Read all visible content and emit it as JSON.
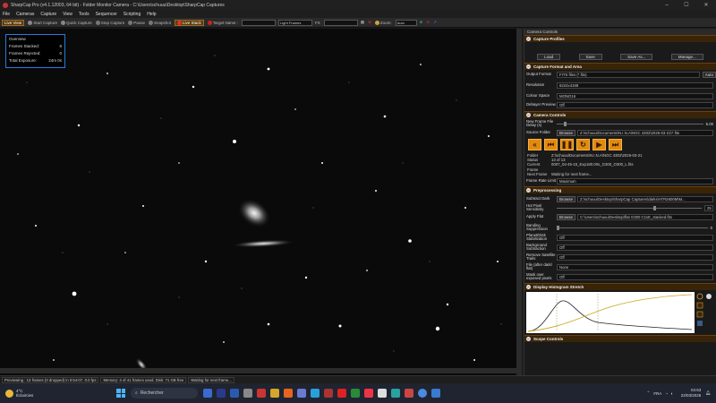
{
  "window": {
    "title": "SharpCap Pro (v4.1.12003, 64 bit) - Folder Monitor Camera - C:\\Users\\schuuu\\Desktop\\SharpCap Captures"
  },
  "menu": [
    "File",
    "Cameras",
    "Capture",
    "View",
    "Tools",
    "Sequencer",
    "Scripting",
    "Help"
  ],
  "toolbar": {
    "live_view": "Live View",
    "start_capture": "Start Capture",
    "quick_capture": "Quick Capture",
    "stop_capture": "Stop Capture",
    "pause": "Pause",
    "snapshot": "Snapshot",
    "live_stack": "Live Stack",
    "target_name": "Target Name :",
    "light_frames": "Light Frames",
    "fx": "FX",
    "zoom_label": "Zoom:",
    "zoom_value": "Auto"
  },
  "overview": {
    "title": "Overview",
    "frames_stacked_label": "Frames Stacked:",
    "frames_stacked": "8",
    "frames_rejected_label": "Frames Rejected:",
    "frames_rejected": "0",
    "total_exposure_label": "Total Exposure:",
    "total_exposure": "24m 0s"
  },
  "panel": {
    "title": "Camera Controls",
    "capture_profiles": "Capture Profiles",
    "load": "Load",
    "save": "Save",
    "save_as": "Save As...",
    "manage": "Manage...",
    "capture_format": "Capture Format and Area",
    "output_format_label": "Output Format",
    "output_format": "FITS files (*.fits)",
    "auto": "Auto",
    "resolution_label": "Resolution",
    "resolution": "6224x4168",
    "colour_space_label": "Colour Space",
    "colour_space": "MONO16",
    "debayer_label": "Debayer Preview",
    "debayer": "Off",
    "camera_controls": "Camera Controls",
    "new_frame_label": "New Frame File Delay (s)",
    "new_frame_value": "5.00",
    "source_folder_label": "Source Folder",
    "browse": "Browse",
    "source_folder": "Z:\\schuuu\\Documents\\N.I.N.A\\NGC 4302\\2026-03-21\\*.fits",
    "folder_label": "Folder",
    "folder": "Z:\\schuuu\\Documents\\N.I.N.A\\NGC 4302\\2026-03-21",
    "status_label": "Status",
    "status": "13 of 13",
    "current_frame_label": "Current Frame",
    "current_frame": "0007_04-45-15_Exp180.00s_G300_O300_L.fits",
    "next_frame_label": "Next Frame",
    "next_frame": "Waiting for next frame...",
    "frame_rate_label": "Frame Rate Limit",
    "frame_rate": "Maximum",
    "preprocessing": "Preprocessing",
    "subtract_dark_label": "Subtract Dark",
    "subtract_dark": "Z:\\schuuu\\Desktop\\SharpCap Captures\\darks\\ATR2600M\\M...",
    "hot_pixel_label": "Hot Pixel Sensitivity",
    "hot_pixel_value": "25",
    "apply_flat_label": "Apply Flat",
    "apply_flat": "C:\\Users\\schuuu\\Desktop\\flat G300 C11E_stacked.fits",
    "banding_label": "Banding Suppression",
    "banding_value": "0",
    "planet_label": "Planet/Disk Stabilization",
    "planet": "Off",
    "background_label": "Background Subtraction",
    "background": "Off",
    "satellite_label": "Remove Satellite Trails",
    "satellite": "Off",
    "file_after_label": "File (after dark/ flat)",
    "file_after": "None",
    "mask_label": "Mask over exposed pixels",
    "mask": "Off",
    "histogram": "Display Histogram Stretch",
    "scope_controls": "Scope Controls"
  },
  "status": {
    "previewing": "Previewing : 13 frames (0 dropped) in 0:54:07, 0.0 fps",
    "memory": "Memory: 4 of 41 frames used. Disk: 71 GB free",
    "waiting": "Waiting for next frame..."
  },
  "taskbar": {
    "temp": "4°C",
    "weather": "Éclaircies",
    "search": "Rechercher",
    "lang": "FRA",
    "time": "04:53",
    "date": "22/03/2026"
  }
}
